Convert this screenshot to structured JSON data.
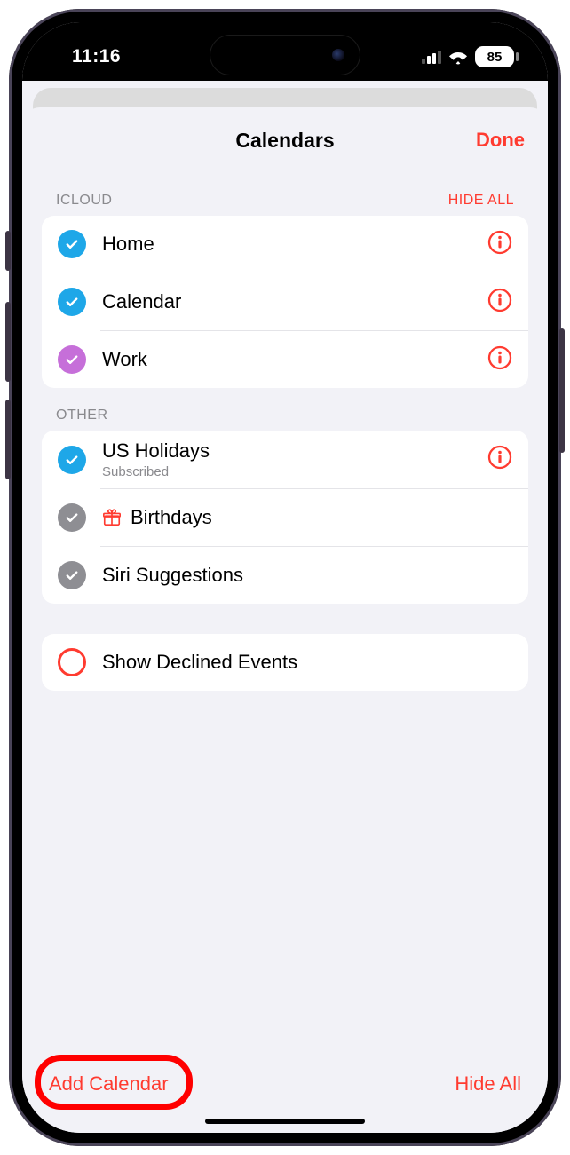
{
  "status_bar": {
    "time": "11:16",
    "battery_pct": "85"
  },
  "nav": {
    "title": "Calendars",
    "done": "Done"
  },
  "sections": {
    "icloud": {
      "label": "ICLOUD",
      "action": "HIDE ALL",
      "items": [
        {
          "name": "Home",
          "color": "#1ea7e8",
          "checked": true,
          "has_info": true
        },
        {
          "name": "Calendar",
          "color": "#1ea7e8",
          "checked": true,
          "has_info": true
        },
        {
          "name": "Work",
          "color": "#c66fd9",
          "checked": true,
          "has_info": true
        }
      ]
    },
    "other": {
      "label": "OTHER",
      "items": [
        {
          "name": "US Holidays",
          "sub": "Subscribed",
          "color": "#1ea7e8",
          "checked": true,
          "has_info": true
        },
        {
          "name": "Birthdays",
          "icon": "gift",
          "color": "#8e8e93",
          "checked": true
        },
        {
          "name": "Siri Suggestions",
          "color": "#8e8e93",
          "checked": true
        }
      ]
    }
  },
  "show_declined": {
    "label": "Show Declined Events",
    "checked": false
  },
  "bottom_bar": {
    "add": "Add Calendar",
    "hide_all": "Hide All"
  },
  "annotation": {
    "highlighted_button": "add-calendar-button"
  }
}
